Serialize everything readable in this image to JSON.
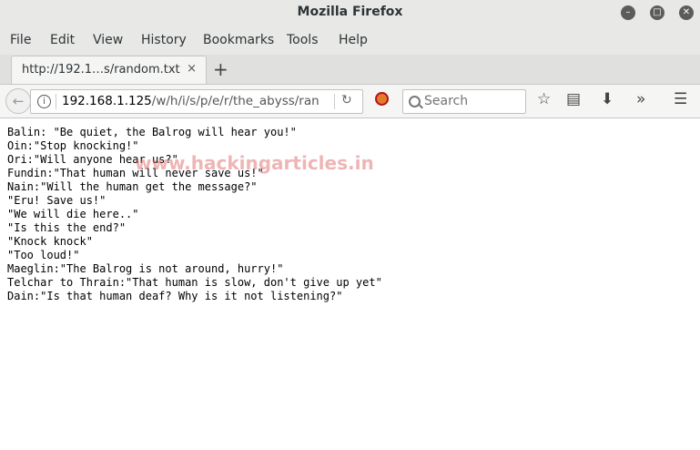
{
  "window": {
    "title": "Mozilla Firefox"
  },
  "menu": {
    "items": [
      "File",
      "Edit",
      "View",
      "History",
      "Bookmarks",
      "Tools",
      "Help"
    ]
  },
  "tab": {
    "title": "http://192.1…s/random.txt",
    "close": "×",
    "new_tab": "+"
  },
  "urlbar": {
    "host": "192.168.1.125",
    "path": "/w/h/i/s/p/e/r/the_abyss/ran"
  },
  "search": {
    "placeholder": "Search"
  },
  "content": {
    "lines": [
      "Balin: \"Be quiet, the Balrog will hear you!\"",
      "Oin:\"Stop knocking!\"",
      "Ori:\"Will anyone hear us?\"",
      "Fundin:\"That human will never save us!\"",
      "Nain:\"Will the human get the message?\"",
      "\"Eru! Save us!\"",
      "\"We will die here..\"",
      "\"Is this the end?\"",
      "\"Knock knock\"",
      "\"Too loud!\"",
      "Maeglin:\"The Balrog is not around, hurry!\"",
      "Telchar to Thrain:\"That human is slow, don't give up yet\"",
      "Dain:\"Is that human deaf? Why is it not listening?\""
    ]
  },
  "watermark": "www.hackingarticles.in"
}
